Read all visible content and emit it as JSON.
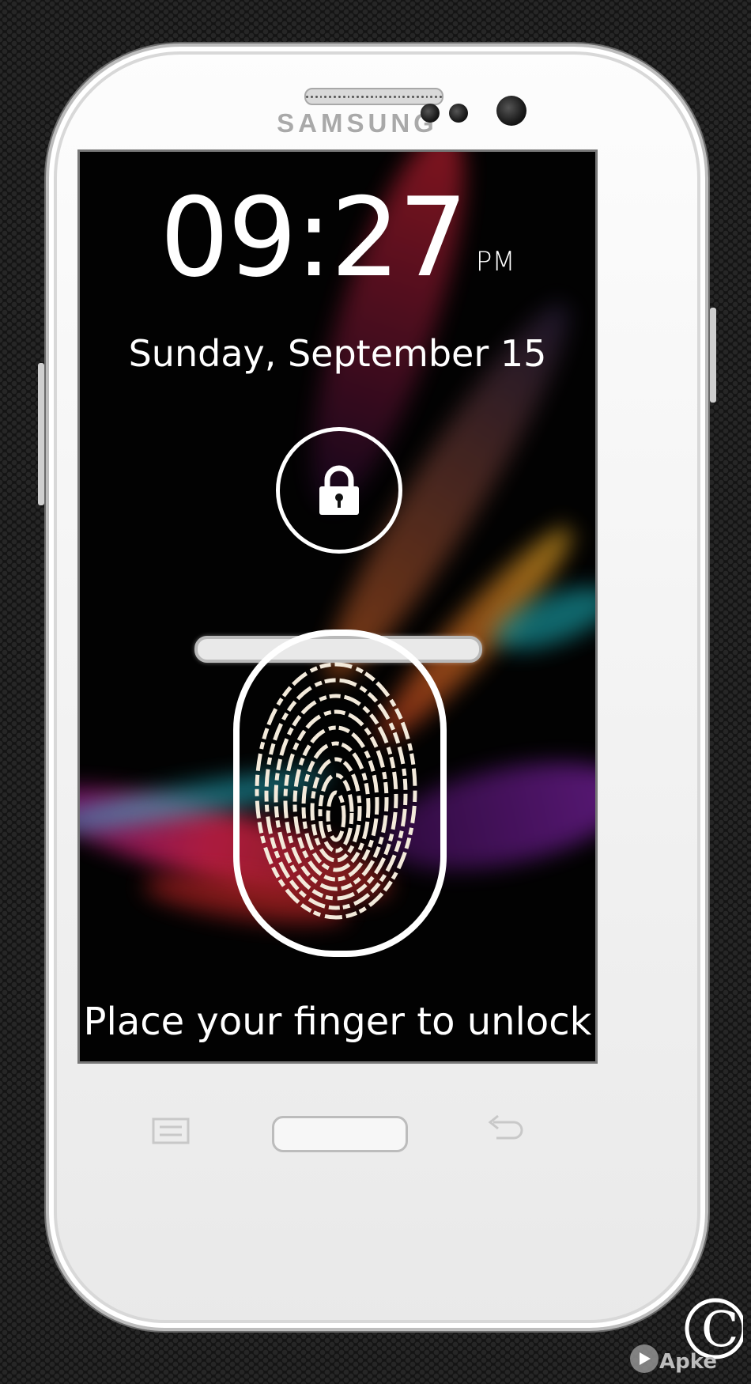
{
  "device": {
    "brand": "SAMSUNG"
  },
  "lockscreen": {
    "time": "09:27",
    "ampm": "PM",
    "date": "Sunday, September 15",
    "unlock_hint": "Place your finger to unlock"
  },
  "icons": {
    "lock": "padlock-icon",
    "fingerprint": "fingerprint-icon",
    "menu": "menu-icon",
    "back": "back-icon"
  },
  "watermark": {
    "text": "Apke"
  },
  "colors": {
    "phone_body": "#f3f3f3",
    "screen_bg": "#020202",
    "text": "#ffffff",
    "fingerprint": "#f3eadb"
  }
}
